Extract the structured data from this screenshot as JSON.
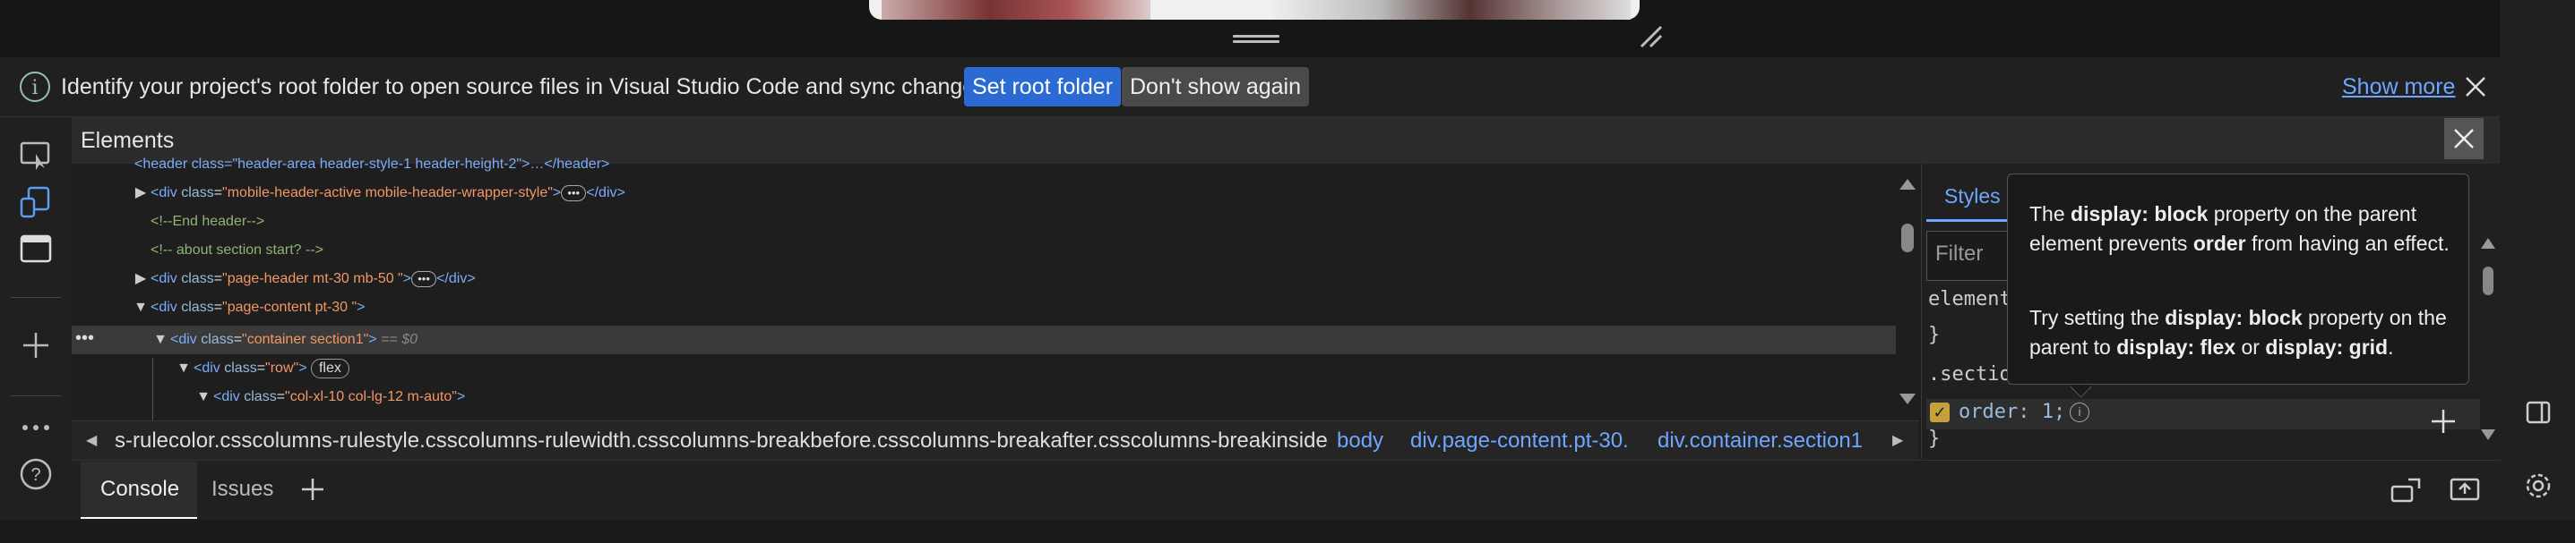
{
  "infobar": {
    "message": "Identify your project's root folder to open source files in Visual Studio Code and sync changes.",
    "set_root_label": "Set root folder",
    "dont_show_label": "Don't show again",
    "show_more_label": "Show more"
  },
  "panel": {
    "title": "Elements"
  },
  "dom": {
    "partial_top": "<header class=\"header-area header-style-1 header-height-2\">…</header>",
    "lines": [
      {
        "tag_open": "<div ",
        "attr": "class",
        "eq": "=",
        "val": "\"mobile-header-active mobile-header-wrapper-style\"",
        "tail": "</div>"
      },
      {
        "comment": "<!--End header-->"
      },
      {
        "comment": "<!-- about section start? -->"
      },
      {
        "tag_open": "<div ",
        "attr": "class",
        "eq": "=",
        "val": "\"page-header mt-30 mb-50 \"",
        "tail": "</div>"
      },
      {
        "tag_open": "<div ",
        "attr": "class",
        "eq": "=",
        "val": "\"page-content pt-30 \"",
        "tail": ">"
      },
      {
        "tag_open": "<div ",
        "attr": "class",
        "eq": "=",
        "val": "\"container section1\"",
        "tail": ">",
        "selected_marker": "== $0"
      },
      {
        "tag_open": "<div ",
        "attr": "class",
        "eq": "=",
        "val": "\"row\"",
        "tail": ">",
        "badge": "flex"
      },
      {
        "tag_open": "<div ",
        "attr": "class",
        "eq": "=",
        "val": "\"col-xl-10 col-lg-12 m-auto\"",
        "tail": ">"
      }
    ]
  },
  "breadcrumbs": [
    "s-rulecolor.csscolumns-rulestyle.csscolumns-rulewidth.csscolumns-breakbefore.csscolumns-breakafter.csscolumns-breakinside",
    "body",
    "div.page-content.pt-30.",
    "div.container.section1"
  ],
  "styles": {
    "tab_label": "Styles",
    "filter_placeholder": "Filter",
    "element_style": "element",
    "brace_close": "}",
    "selector": ".sectio",
    "declaration": "order: 1;"
  },
  "tooltip": {
    "p1_a": "The ",
    "p1_b": "display: block",
    "p1_c": " property on the parent element prevents ",
    "p1_d": "order",
    "p1_e": " from having an effect.",
    "p2_a": "Try setting the ",
    "p2_b": "display: block",
    "p2_c": " property on the parent to ",
    "p2_d": "display: flex",
    "p2_e": " or ",
    "p2_f": "display: grid",
    "p2_g": "."
  },
  "drawer": {
    "console_label": "Console",
    "issues_label": "Issues"
  },
  "colors": {
    "accent": "#2a6ad2",
    "link": "#6ea6ff"
  }
}
